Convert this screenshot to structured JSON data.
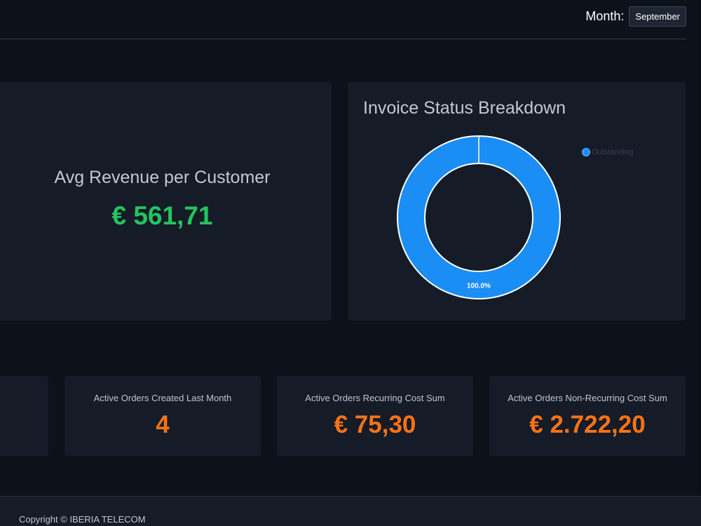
{
  "header": {
    "month_label": "Month:",
    "month_value": "September"
  },
  "avg_card": {
    "title": "Avg Revenue per Customer",
    "value": "€ 561,71",
    "value_color": "#22c55e"
  },
  "invoice_card": {
    "title": "Invoice Status Breakdown",
    "legend": [
      {
        "label": "Outstanding",
        "color": "#1a8ef5"
      }
    ]
  },
  "chart_data": {
    "type": "pie",
    "variant": "doughnut",
    "title": "Invoice Status Breakdown",
    "categories": [
      "Outstanding"
    ],
    "values": [
      100.0
    ],
    "data_labels": [
      "100.0%"
    ],
    "colors": [
      "#1a8ef5"
    ],
    "legend": "top-right"
  },
  "stats": [
    {
      "title": "",
      "value": ""
    },
    {
      "title": "Active Orders Created Last Month",
      "value": "4"
    },
    {
      "title": "Active Orders Recurring Cost Sum",
      "value": "€ 75,30"
    },
    {
      "title": "Active Orders Non-Recurring Cost Sum",
      "value": "€ 2.722,20"
    }
  ],
  "stat_color": "#f97316",
  "footer": {
    "copyright": "Copyright © IBERIA TELECOM"
  }
}
